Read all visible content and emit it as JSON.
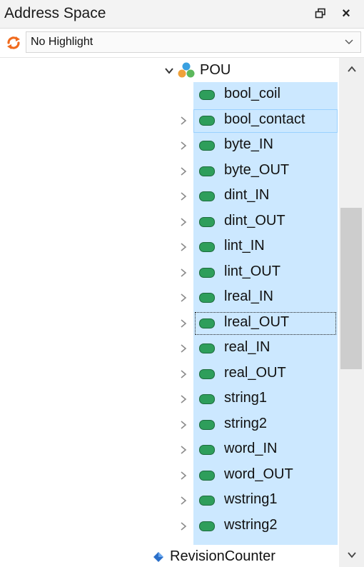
{
  "panel": {
    "title": "Address Space",
    "restore_icon": "window-restore-icon",
    "close_label": "×"
  },
  "highlight": {
    "selected": "No Highlight",
    "icon": "refresh-icon"
  },
  "tree": {
    "root": {
      "label": "POU",
      "icon": "object-cluster-icon",
      "expanded": true
    },
    "items": [
      {
        "label": "bool_coil",
        "has_children": false
      },
      {
        "label": "bool_contact",
        "has_children": true
      },
      {
        "label": "byte_IN",
        "has_children": true
      },
      {
        "label": "byte_OUT",
        "has_children": true
      },
      {
        "label": "dint_IN",
        "has_children": true
      },
      {
        "label": "dint_OUT",
        "has_children": true
      },
      {
        "label": "lint_IN",
        "has_children": true
      },
      {
        "label": "lint_OUT",
        "has_children": true
      },
      {
        "label": "lreal_IN",
        "has_children": true
      },
      {
        "label": "lreal_OUT",
        "has_children": true
      },
      {
        "label": "real_IN",
        "has_children": true
      },
      {
        "label": "real_OUT",
        "has_children": true
      },
      {
        "label": "string1",
        "has_children": true
      },
      {
        "label": "string2",
        "has_children": true
      },
      {
        "label": "word_IN",
        "has_children": true
      },
      {
        "label": "word_OUT",
        "has_children": true
      },
      {
        "label": "wstring1",
        "has_children": true
      },
      {
        "label": "wstring2",
        "has_children": true
      }
    ],
    "last": {
      "label": "RevisionCounter",
      "icon": "property-diamond-icon"
    }
  },
  "colors": {
    "selection": "#cce8ff",
    "selection_border": "#99d1ff",
    "tag_icon": "#2e9e5b",
    "scroll_thumb": "#cdcdcd"
  }
}
